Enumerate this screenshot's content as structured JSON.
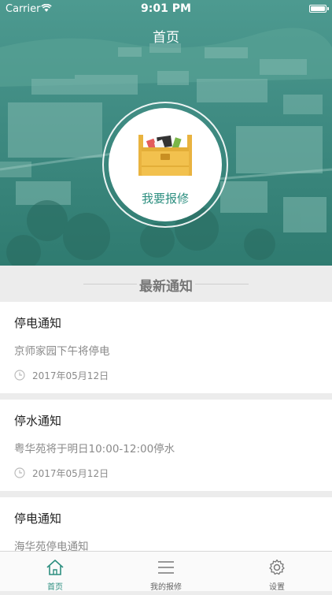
{
  "status_bar": {
    "carrier": "Carrier",
    "time": "9:01 PM"
  },
  "header": {
    "title": "首页"
  },
  "repair": {
    "label": "我要报修",
    "icon": "toolbox-icon"
  },
  "notices": {
    "section_title": "最新通知",
    "items": [
      {
        "title": "停电通知",
        "body": "京师家园下午将停电",
        "date": "2017年05月12日"
      },
      {
        "title": "停水通知",
        "body": "粤华苑将于明日10:00-12:00停水",
        "date": "2017年05月12日"
      },
      {
        "title": "停电通知",
        "body": "海华苑停电通知",
        "date": ""
      }
    ]
  },
  "tabs": [
    {
      "label": "首页",
      "icon": "home-icon",
      "active": true
    },
    {
      "label": "我的报修",
      "icon": "list-icon",
      "active": false
    },
    {
      "label": "设置",
      "icon": "gear-icon",
      "active": false
    }
  ],
  "colors": {
    "accent": "#2d8f80",
    "hero_tint": "#3f8f86",
    "toolbox": "#f0c14b"
  }
}
